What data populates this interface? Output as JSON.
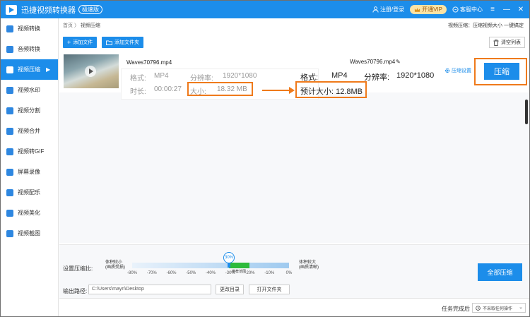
{
  "app": {
    "title": "迅捷视频转换器",
    "badge": "极速版",
    "login": "注册/登录",
    "vip": "开通VIP",
    "help": "客服中心",
    "menu_glyph": "≡",
    "minimize_glyph": "—",
    "close_glyph": "✕"
  },
  "sidebar": {
    "items": [
      {
        "label": "视频转换",
        "icon": "video-convert-icon"
      },
      {
        "label": "音频转换",
        "icon": "audio-convert-icon"
      },
      {
        "label": "视频压缩",
        "icon": "video-compress-icon",
        "active": true
      },
      {
        "label": "视频水印",
        "icon": "watermark-icon"
      },
      {
        "label": "视频分割",
        "icon": "split-icon"
      },
      {
        "label": "视频合并",
        "icon": "merge-icon"
      },
      {
        "label": "视频转GIF",
        "icon": "gif-icon"
      },
      {
        "label": "屏幕录像",
        "icon": "screen-record-icon"
      },
      {
        "label": "视频配乐",
        "icon": "music-icon"
      },
      {
        "label": "视频美化",
        "icon": "beautify-icon"
      },
      {
        "label": "视频截图",
        "icon": "screenshot-icon"
      }
    ],
    "active_arrow": "▶"
  },
  "breadcrumb": {
    "home": "首页",
    "sep": "〉",
    "current": "视频压缩"
  },
  "hint": "视频压缩：压缩视频大小 一键搞定",
  "toolbar": {
    "add_file": "添加文件",
    "add_folder": "添加文件夹",
    "clear": "清空列表"
  },
  "file": {
    "source_name": "Waves70796.mp4",
    "format_label": "格式:",
    "format": "MP4",
    "resolution_label": "分辨率:",
    "resolution": "1920*1080",
    "duration_label": "时长:",
    "duration": "00:00:27",
    "size_label": "大小:",
    "size": "18.32 MB",
    "output_name": "Waves70796.mp4",
    "edit_glyph": "✎",
    "out_format_label": "格式:",
    "out_format": "MP4",
    "out_resolution_label": "分辨率:",
    "out_resolution": "1920*1080",
    "estimated": "预计大小: 12.8MB",
    "settings": "压缩设置",
    "compress": "压缩"
  },
  "compress_settings": {
    "ratio_label": "设置压缩比:",
    "left_label": "体积较小",
    "left_sub": "(画质受损)",
    "right_label": "体积较大",
    "right_sub": "(画质清晰)",
    "value": "30%",
    "recommended": "推荐范围",
    "ticks": [
      "-80%",
      "-70%",
      "-60%",
      "-50%",
      "-40%",
      "-30%",
      "-20%",
      "-10%",
      "0%"
    ],
    "output_label": "输出路径:",
    "output_path": "C:\\Users\\mayn\\Desktop",
    "change_dir": "更改目录",
    "open_folder": "打开文件夹",
    "compress_all": "全部压缩"
  },
  "footer": {
    "after_label": "任务完成后",
    "after_value": "不采取任何操作",
    "caret": "⌄"
  },
  "colors": {
    "accent": "#1c8dea",
    "highlight": "#ef7a1b",
    "green": "#2dbb3b"
  }
}
